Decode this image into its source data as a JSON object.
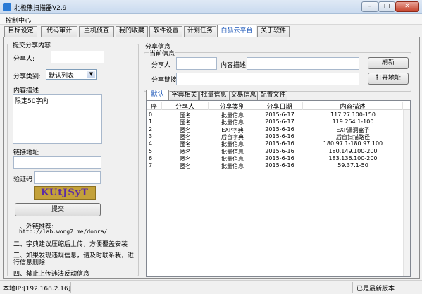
{
  "window": {
    "title": "北极熊扫描器V2.9",
    "minimize": "–",
    "maximize": "□",
    "close": "✕"
  },
  "menu": {
    "control_center": "控制中心"
  },
  "tabs": [
    "目标设定",
    "代码审计",
    "主机侦查",
    "我的收藏",
    "软件设置",
    "计划任务",
    "白狐云平台",
    "关于软件"
  ],
  "active_tab": "白狐云平台",
  "submit_panel": {
    "title": "提交分享内容",
    "sharer_label": "分享人:",
    "sharer_value": "",
    "category_label": "分享类别:",
    "category_value": "默认列表",
    "desc_label": "内容描述",
    "desc_value": "限定50字内",
    "link_label": "链接地址",
    "link_value": "",
    "captcha_label": "验证码",
    "captcha_value": "",
    "captcha_image_text": "KUtJSyT",
    "submit_button": "提交",
    "notes": [
      "一、外链推荐:",
      "http://lab.wong2.me/doora/",
      "二、字典建议压缩后上传，方便覆盖安装",
      "三、如果发现违规信息，请及时联系我，进",
      "行信息删除",
      "四、禁止上传违法反动信息"
    ]
  },
  "share_info": {
    "title": "分享信息",
    "current_title": "当前信息",
    "sharer_label": "分享人",
    "sharer_value": "",
    "desc_label": "内容描述",
    "desc_value": "",
    "link_label": "分享链接",
    "link_value": "",
    "refresh_button": "刷新",
    "open_button": "打开地址"
  },
  "inner_tabs": [
    "默认",
    "字典相关",
    "批量信息",
    "交易信息",
    "配置文件"
  ],
  "active_inner_tab": "默认",
  "table": {
    "columns": [
      "序",
      "分享人",
      "分享类别",
      "分享日期",
      "内容描述"
    ],
    "rows": [
      [
        "0",
        "匿名",
        "批量信息",
        "2015-6-17",
        "117.27.100-150"
      ],
      [
        "1",
        "匿名",
        "批量信息",
        "2015-6-17",
        "119.254.1-100"
      ],
      [
        "2",
        "匿名",
        "EXP字典",
        "2015-6-16",
        "EXP漏洞盒子"
      ],
      [
        "3",
        "匿名",
        "后台字典",
        "2015-6-16",
        "后台扫描路径"
      ],
      [
        "4",
        "匿名",
        "批量信息",
        "2015-6-16",
        "180.97.1-180.97.100"
      ],
      [
        "5",
        "匿名",
        "批量信息",
        "2015-6-16",
        "180.149.100-200"
      ],
      [
        "6",
        "匿名",
        "批量信息",
        "2015-6-16",
        "183.136.100-200"
      ],
      [
        "7",
        "匿名",
        "批量信息",
        "2015-6-16",
        "59.37.1-50"
      ]
    ]
  },
  "status": {
    "local_ip": "本地IP:[192.168.2.16]",
    "version": "已是最新版本"
  },
  "colors": {
    "active_tab_text": "#1a55b8",
    "captcha_bg": "#c3a13a",
    "captcha_text": "#5b2ba6"
  },
  "icons": {
    "app": "app-logo-icon",
    "dropdown": "chevron-down-icon"
  }
}
